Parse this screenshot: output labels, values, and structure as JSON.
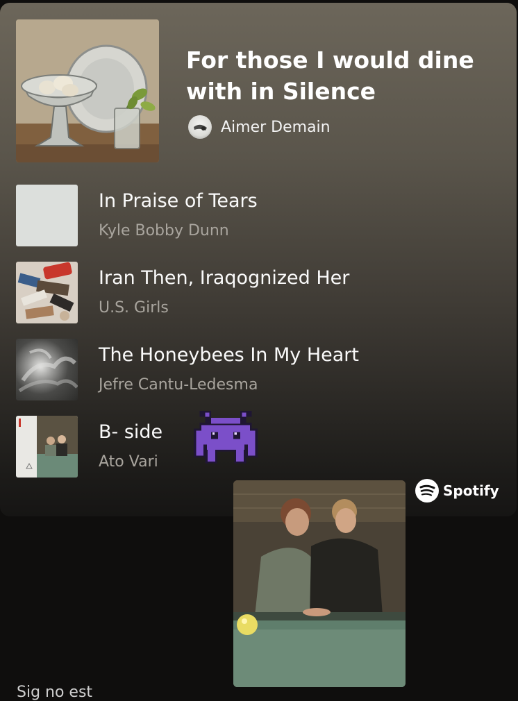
{
  "playlist": {
    "title": "For those I would dine with in Silence",
    "owner": "Aimer Demain",
    "cover_icon": "still-life-painting"
  },
  "tracks": [
    {
      "title": "In Praise of Tears",
      "artist": "Kyle Bobby Dunn",
      "art": "pale-grey-cover"
    },
    {
      "title": "Iran Then, Iraqognized Her",
      "artist": "U.S. Girls",
      "art": "collage-cover"
    },
    {
      "title": "The Honeybees In My Heart",
      "artist": "Jefre Cantu-Ledesma",
      "art": "smoke-cover"
    },
    {
      "title": "B- side",
      "artist": "Ato Vari",
      "art": "billiard-cover"
    }
  ],
  "sticker": {
    "icon": "alien-monster-emoji"
  },
  "brand": {
    "name": "Spotify",
    "icon": "spotify-logo-icon"
  },
  "footer": {
    "text": "Sig no est"
  },
  "colors": {
    "card_top": "#6c665a",
    "card_bottom": "#161514",
    "artist_text": "#a9a59e",
    "invader": "#7b4fc9"
  }
}
